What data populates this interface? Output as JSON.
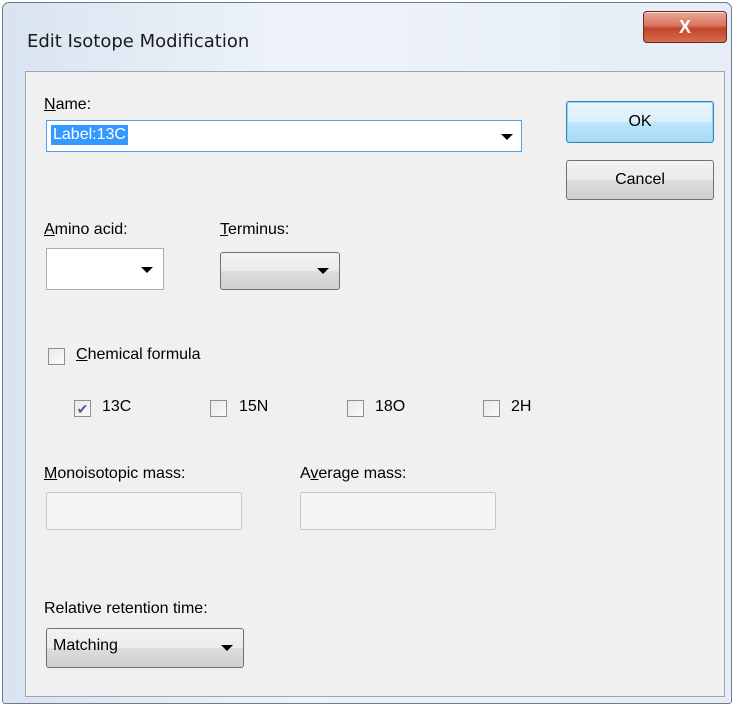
{
  "window": {
    "title": "Edit Isotope Modification",
    "close_glyph": "X"
  },
  "name": {
    "label_prefix": "",
    "label_mnemonic": "N",
    "label_rest": "ame:",
    "value": "Label:13C"
  },
  "buttons": {
    "ok": "OK",
    "cancel": "Cancel"
  },
  "amino_acid": {
    "label_mnemonic": "A",
    "label_rest": "mino acid:",
    "value": ""
  },
  "terminus": {
    "label_mnemonic": "T",
    "label_rest": "erminus:",
    "value": ""
  },
  "chemical_formula": {
    "label_mnemonic": "C",
    "label_rest": "hemical formula",
    "checked": false
  },
  "isotopes": [
    {
      "label": "13C",
      "checked": true
    },
    {
      "label": "15N",
      "checked": false
    },
    {
      "label": "18O",
      "checked": false
    },
    {
      "label": "2H",
      "checked": false
    }
  ],
  "monoisotopic_mass": {
    "label_mnemonic": "M",
    "label_rest": "onoisotopic mass:",
    "value": ""
  },
  "average_mass": {
    "label_prefix": "A",
    "label_mnemonic": "v",
    "label_rest": "erage mass:",
    "value": ""
  },
  "retention": {
    "label": "Relative retention time:",
    "value": "Matching"
  },
  "colors": {
    "selection": "#3399ff",
    "focus_border": "#569de5",
    "check_mark": "#4a5f97"
  }
}
